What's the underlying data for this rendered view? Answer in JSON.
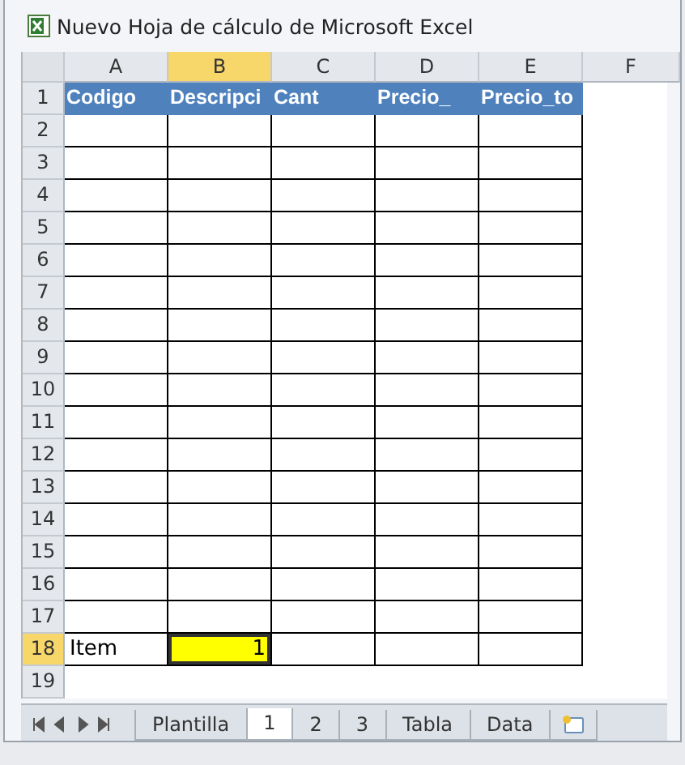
{
  "window": {
    "title": "Nuevo Hoja de cálculo de Microsoft Excel"
  },
  "sheet": {
    "columns": [
      {
        "label": "A",
        "selected": false
      },
      {
        "label": "B",
        "selected": true
      },
      {
        "label": "C",
        "selected": false
      },
      {
        "label": "D",
        "selected": false
      },
      {
        "label": "E",
        "selected": false
      },
      {
        "label": "F",
        "selected": false
      }
    ],
    "rows": [
      {
        "label": "1",
        "selected": false,
        "kind": "header",
        "cells": [
          {
            "text": "Codigo"
          },
          {
            "text": "Descripci"
          },
          {
            "text": "Cant"
          },
          {
            "text": "Precio_"
          },
          {
            "text": "Precio_to"
          }
        ]
      },
      {
        "label": "2",
        "selected": false,
        "kind": "table"
      },
      {
        "label": "3",
        "selected": false,
        "kind": "table"
      },
      {
        "label": "4",
        "selected": false,
        "kind": "table"
      },
      {
        "label": "5",
        "selected": false,
        "kind": "table"
      },
      {
        "label": "6",
        "selected": false,
        "kind": "table"
      },
      {
        "label": "7",
        "selected": false,
        "kind": "table"
      },
      {
        "label": "8",
        "selected": false,
        "kind": "table"
      },
      {
        "label": "9",
        "selected": false,
        "kind": "table"
      },
      {
        "label": "10",
        "selected": false,
        "kind": "table"
      },
      {
        "label": "11",
        "selected": false,
        "kind": "table"
      },
      {
        "label": "12",
        "selected": false,
        "kind": "table"
      },
      {
        "label": "13",
        "selected": false,
        "kind": "table"
      },
      {
        "label": "14",
        "selected": false,
        "kind": "table"
      },
      {
        "label": "15",
        "selected": false,
        "kind": "table"
      },
      {
        "label": "16",
        "selected": false,
        "kind": "table"
      },
      {
        "label": "17",
        "selected": false,
        "kind": "table"
      },
      {
        "label": "18",
        "selected": true,
        "kind": "table",
        "cells": [
          {
            "text": "Item",
            "kind": "text"
          },
          {
            "text": "1",
            "kind": "number",
            "selected": true,
            "color": "#ffff00"
          }
        ]
      },
      {
        "label": "19",
        "selected": false,
        "kind": "plain"
      }
    ]
  },
  "sheet_tabs": [
    {
      "label": "Plantilla",
      "selected": false
    },
    {
      "label": "1",
      "selected": true
    },
    {
      "label": "2",
      "selected": false
    },
    {
      "label": "3",
      "selected": false
    },
    {
      "label": "Tabla",
      "selected": false
    },
    {
      "label": "Data",
      "selected": false
    }
  ]
}
